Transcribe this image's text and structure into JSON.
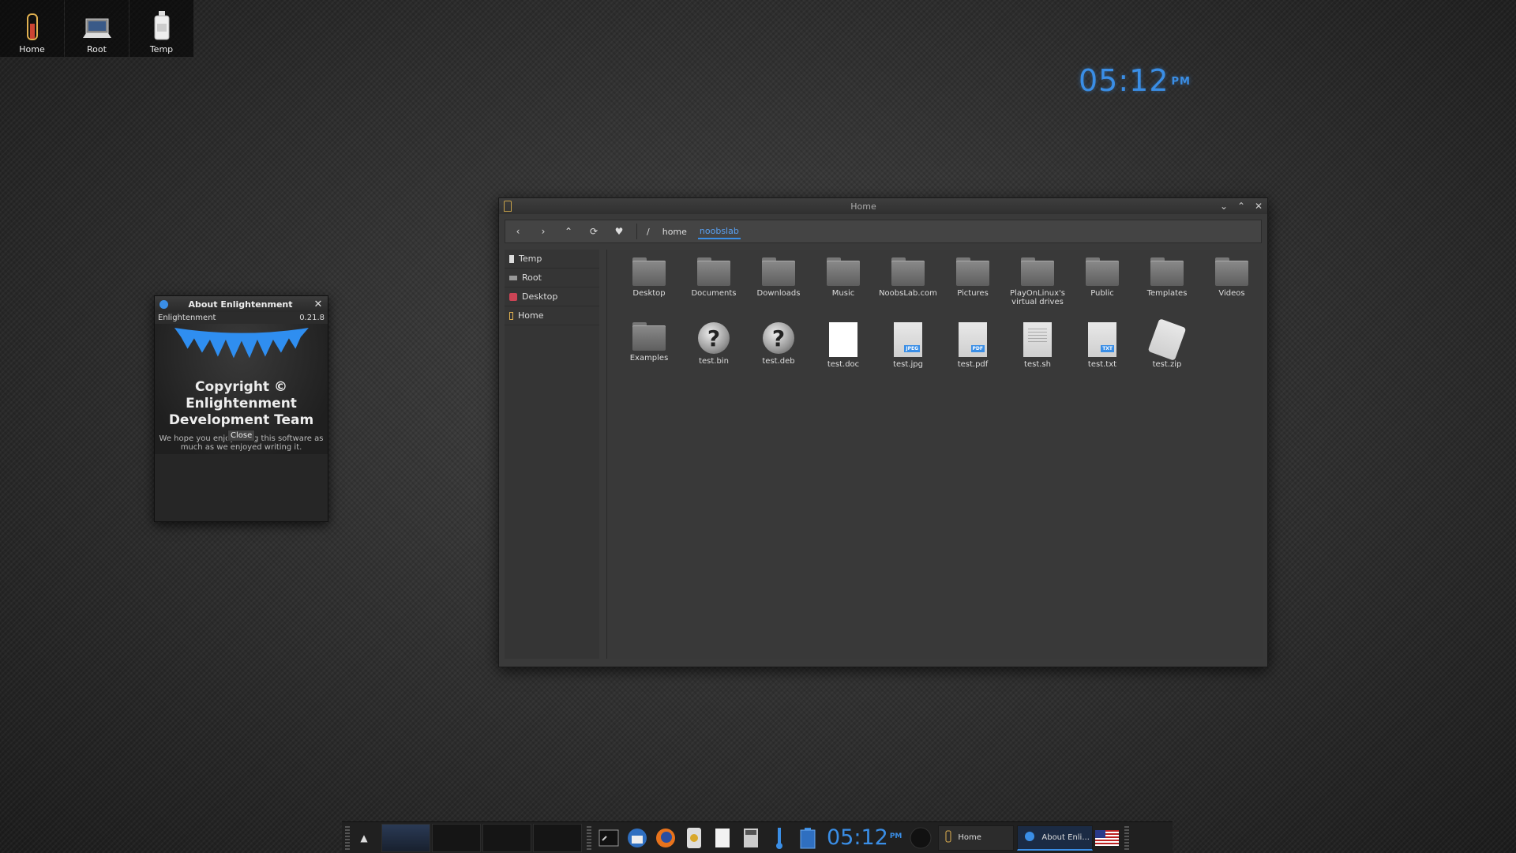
{
  "desktop_icons": [
    {
      "label": "Home",
      "icon": "home-icon"
    },
    {
      "label": "Root",
      "icon": "root-drive-icon"
    },
    {
      "label": "Temp",
      "icon": "temp-icon"
    }
  ],
  "clock": {
    "time": "05:12",
    "ampm": "PM"
  },
  "about": {
    "title": "About Enlightenment",
    "app_name": "Enlightenment",
    "version": "0.21.8",
    "copyright_lines": [
      "Copyright ©",
      "Enlightenment",
      "Development Team"
    ],
    "hope_lines": [
      "We hope you enjoy using this software as",
      "much as we enjoyed writing it."
    ],
    "close_label": "Close"
  },
  "file_manager": {
    "title": "Home",
    "path": {
      "root": "/",
      "crumbs": [
        "home",
        "noobslab"
      ]
    },
    "sidebar": [
      {
        "label": "Temp",
        "icon": "temp-icon"
      },
      {
        "label": "Root",
        "icon": "root-drive-icon"
      },
      {
        "label": "Desktop",
        "icon": "desktop-icon"
      },
      {
        "label": "Home",
        "icon": "home-icon"
      }
    ],
    "files": [
      {
        "name": "Desktop",
        "kind": "folder"
      },
      {
        "name": "Documents",
        "kind": "folder"
      },
      {
        "name": "Downloads",
        "kind": "folder"
      },
      {
        "name": "Music",
        "kind": "folder"
      },
      {
        "name": "NoobsLab.com",
        "kind": "folder"
      },
      {
        "name": "Pictures",
        "kind": "folder"
      },
      {
        "name": "PlayOnLinux's virtual drives",
        "kind": "folder"
      },
      {
        "name": "Public",
        "kind": "folder"
      },
      {
        "name": "Templates",
        "kind": "folder"
      },
      {
        "name": "Videos",
        "kind": "folder"
      },
      {
        "name": "Examples",
        "kind": "folder"
      },
      {
        "name": "test.bin",
        "kind": "unknown"
      },
      {
        "name": "test.deb",
        "kind": "unknown"
      },
      {
        "name": "test.doc",
        "kind": "blank"
      },
      {
        "name": "test.jpg",
        "kind": "doc",
        "tag": "JPEG"
      },
      {
        "name": "test.pdf",
        "kind": "doc",
        "tag": "PDF"
      },
      {
        "name": "test.sh",
        "kind": "text"
      },
      {
        "name": "test.txt",
        "kind": "doc",
        "tag": "TXT"
      },
      {
        "name": "test.zip",
        "kind": "zip"
      }
    ]
  },
  "taskbar": {
    "clock": {
      "time": "05:12",
      "ampm": "PM"
    },
    "tasks": [
      {
        "label": "Home",
        "active": false
      },
      {
        "label": "About Enli...",
        "active": true
      }
    ],
    "launchers": [
      "terminal-icon",
      "thunderbird-icon",
      "firefox-icon",
      "media-player-icon",
      "text-editor-icon",
      "calculator-icon",
      "thermometer-icon",
      "battery-icon"
    ]
  },
  "colors": {
    "accent": "#3a8ee6",
    "background": "#2e2e2e",
    "window": "#3a3a3a"
  }
}
